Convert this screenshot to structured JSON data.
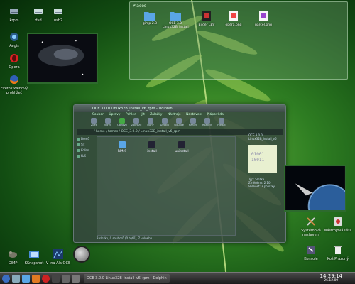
{
  "desktop_icons": [
    {
      "label": "krpm"
    },
    {
      "label": "dvd"
    },
    {
      "label": "usb2"
    },
    {
      "label": "Aegis"
    },
    {
      "label": "Opera"
    },
    {
      "label": "Firefox Webový prohlížeč"
    }
  ],
  "bottom_icons": [
    {
      "label": "GIMP"
    },
    {
      "label": "KSnapshot"
    },
    {
      "label": "V-Ina Ala OCE"
    }
  ],
  "right_icons": [
    {
      "label": "Systémová nastavení"
    },
    {
      "label": "Nástrojová lišta"
    },
    {
      "label": "Konsole"
    },
    {
      "label": "Koš Prázdný"
    }
  ],
  "folderview": {
    "title": "Places",
    "items": [
      {
        "label": "gimp-2.8"
      },
      {
        "label": "OCE 3.0 Linux32B_install"
      },
      {
        "label": "Bilder LBV"
      },
      {
        "label": "opera.png"
      },
      {
        "label": "parcel.png"
      }
    ]
  },
  "dolphin": {
    "title": "OCE 3.0.0 Linux32B_install_v6_rpm - Dolphin",
    "menu": [
      "Soubor",
      "Úpravy",
      "Pohled",
      "Jít",
      "Záložky",
      "Nástroje",
      "Nastavení",
      "Nápověda"
    ],
    "toolbar": [
      "Zpět",
      "Vpřed",
      "Obnovit",
      "Zobrazit",
      "Ikony",
      "Detaily",
      "Sloupce",
      "Náhled",
      "Rozdělit",
      "Hledat"
    ],
    "address": "/ home / tomas / OCE_3.0.0 / Linux32B_install_v6_rpm",
    "places": [
      "Domů",
      "Síť",
      "Kořen",
      "Koš"
    ],
    "files": [
      {
        "label": "RPMS"
      },
      {
        "label": "install"
      },
      {
        "label": "uninstall"
      }
    ],
    "status": "3 složky, 0 souborů (0 bytů), 7 volného",
    "info_title": "OCE 3.0.0 Linux32B_install_v6",
    "info_lines": [
      "Typ: Složka",
      "Změněno: 2.10.",
      "Velikost: 3 položky"
    ],
    "info_glyph": "01001 10011"
  },
  "taskbar": {
    "window": "OCE 3.0.0 Linux32B_install_v6_rpm - Dolphin",
    "time": "14:29:14",
    "date": "26.12.09"
  },
  "colors": {
    "accent": "#2e7d22"
  }
}
